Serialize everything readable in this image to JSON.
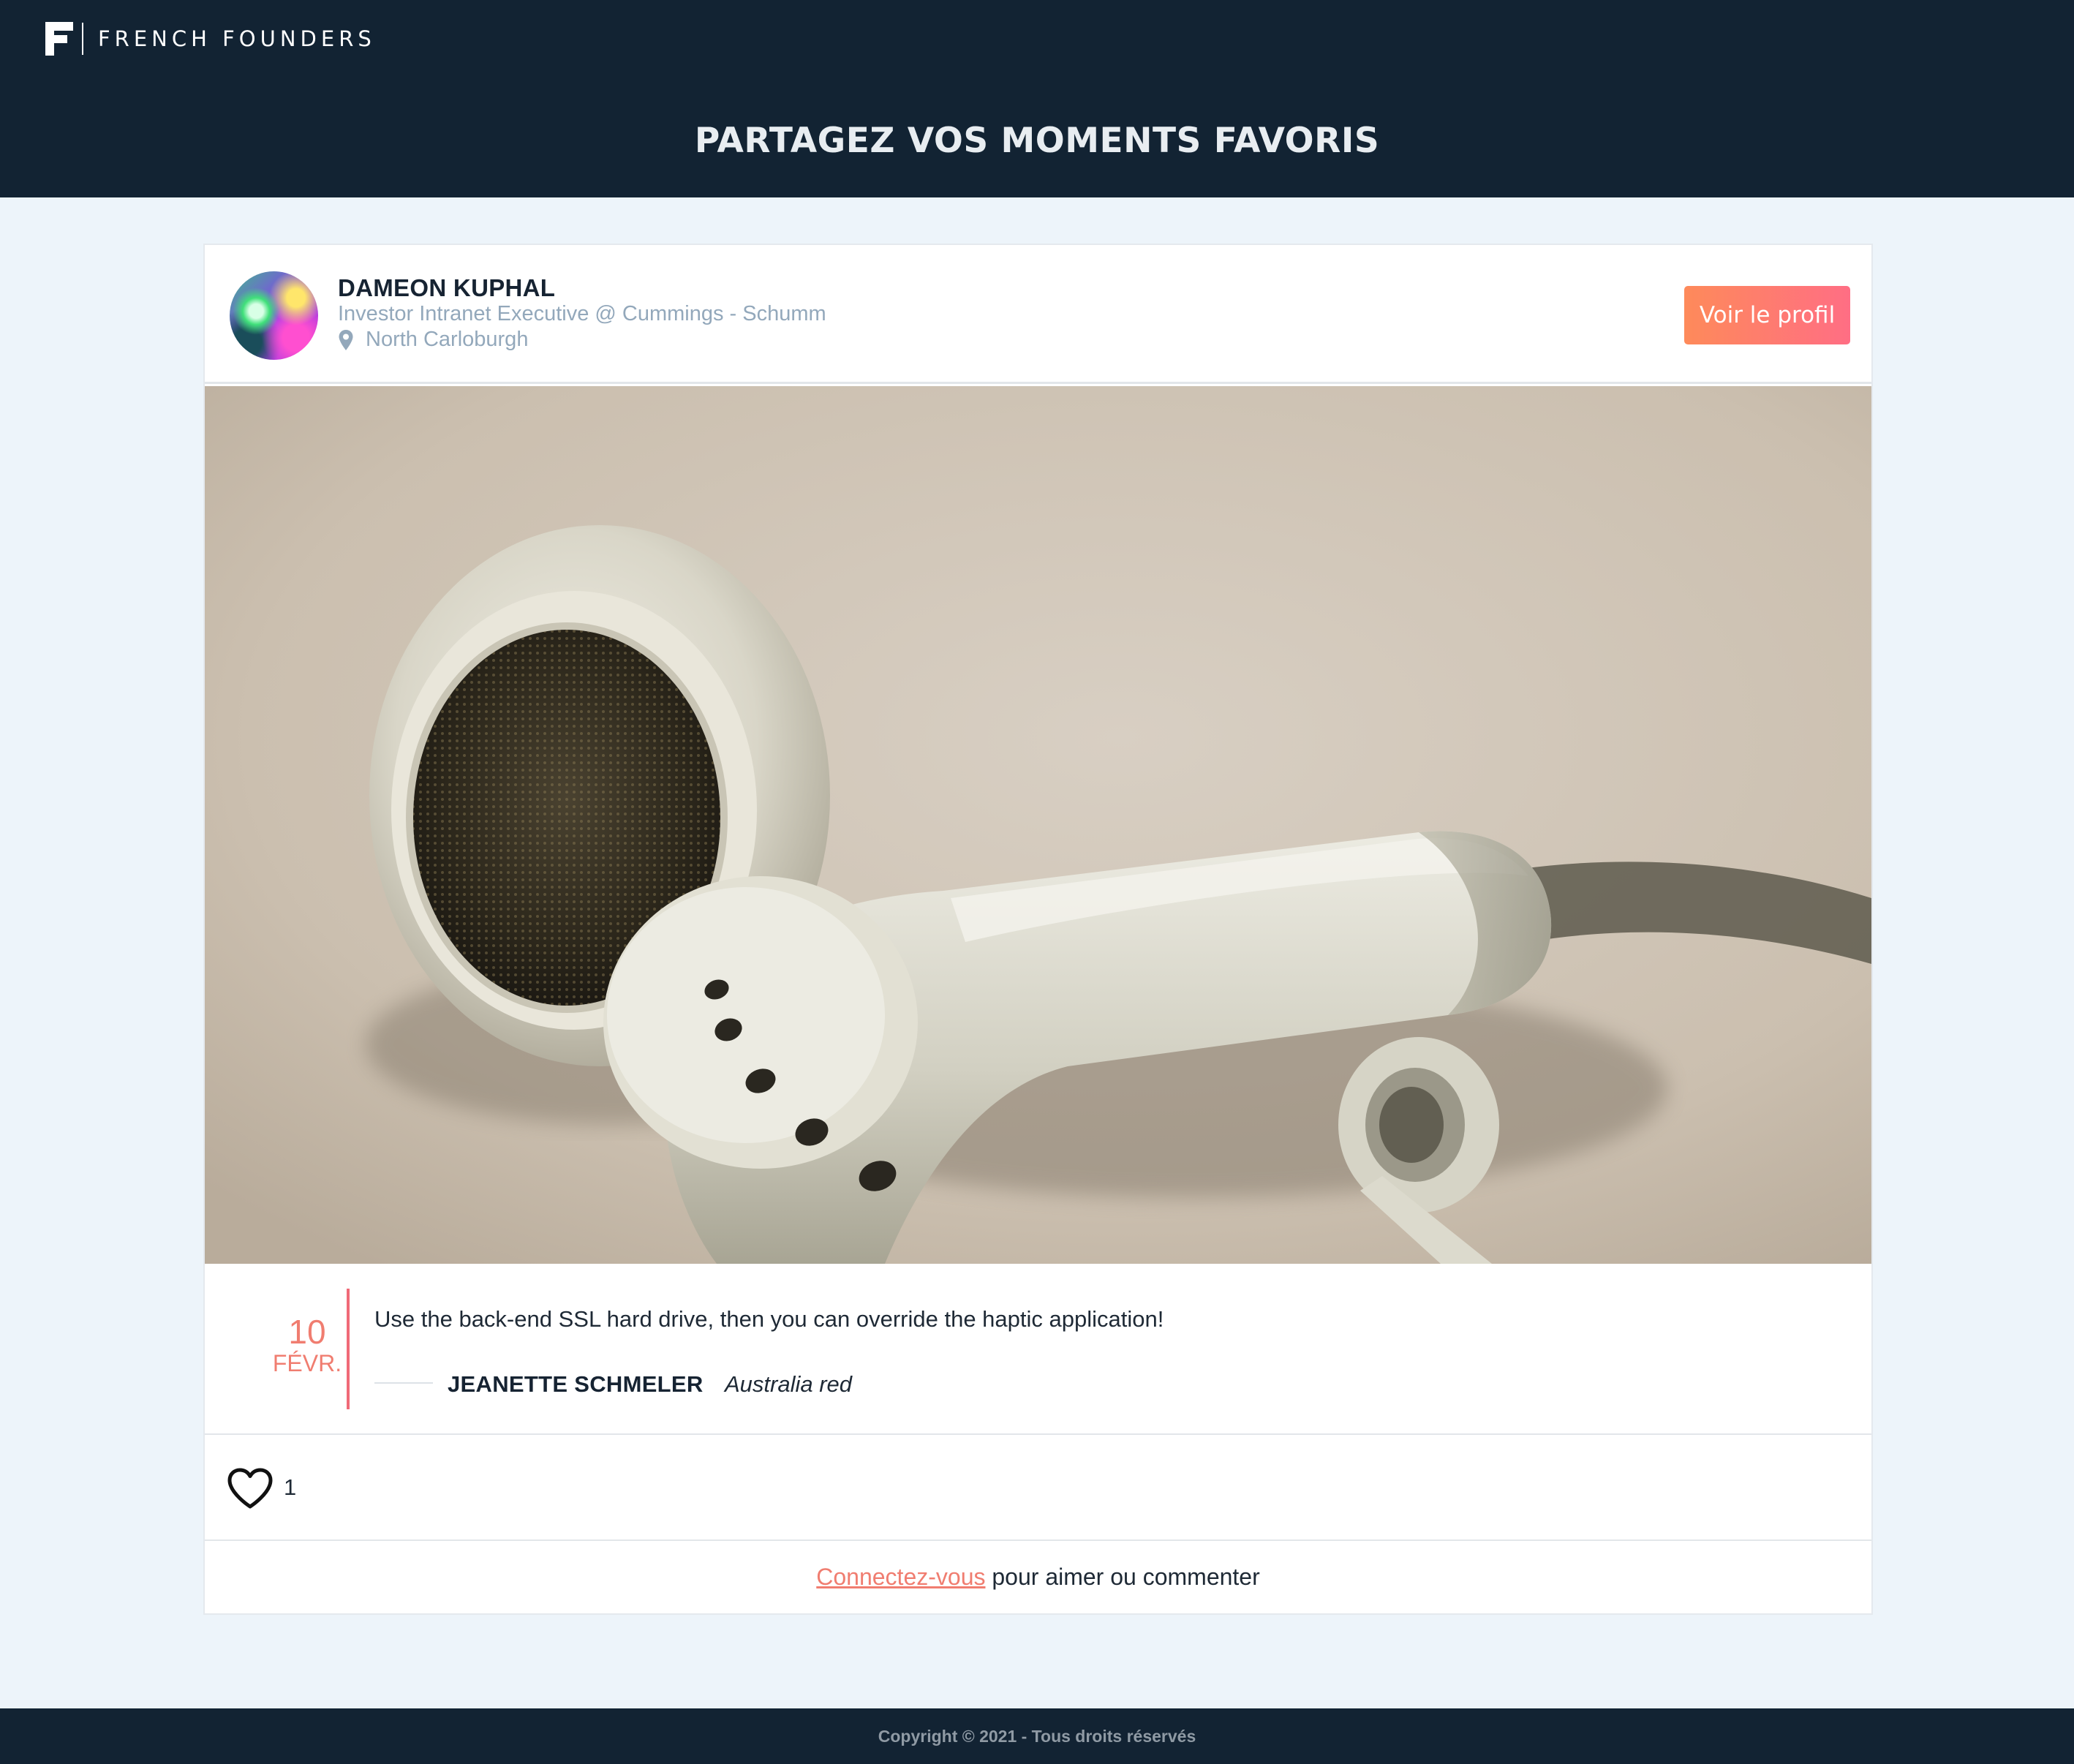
{
  "header": {
    "brand": "FRENCH FOUNDERS",
    "title": "PARTAGEZ VOS MOMENTS FAVORIS"
  },
  "post": {
    "author": {
      "name": "DAMEON KUPHAL",
      "role": "Investor Intranet Executive @ Cummings - Schumm",
      "location": "North Carloburgh"
    },
    "profile_button_label": "Voir le profil",
    "date": {
      "day": "10",
      "month": "FÉVR."
    },
    "text": "Use the back-end SSL hard drive, then you can override the haptic application!",
    "signature": {
      "name": "JEANETTE SCHMELER",
      "company": "Australia red"
    },
    "likes": "1",
    "login_prompt": {
      "link": "Connectez-vous",
      "rest": " pour aimer ou commenter"
    }
  },
  "footer": {
    "copyright": "Copyright © 2021 - Tous droits réservés"
  },
  "colors": {
    "header_bg": "#122333",
    "page_bg": "#edf4fa",
    "accent": "#f07d70",
    "button_gradient_start": "#fe8a5a",
    "button_gradient_end": "#ff6e84"
  },
  "icons": {
    "logo": "french-founders-logo-icon",
    "location": "map-pin-icon",
    "like": "heart-icon"
  }
}
